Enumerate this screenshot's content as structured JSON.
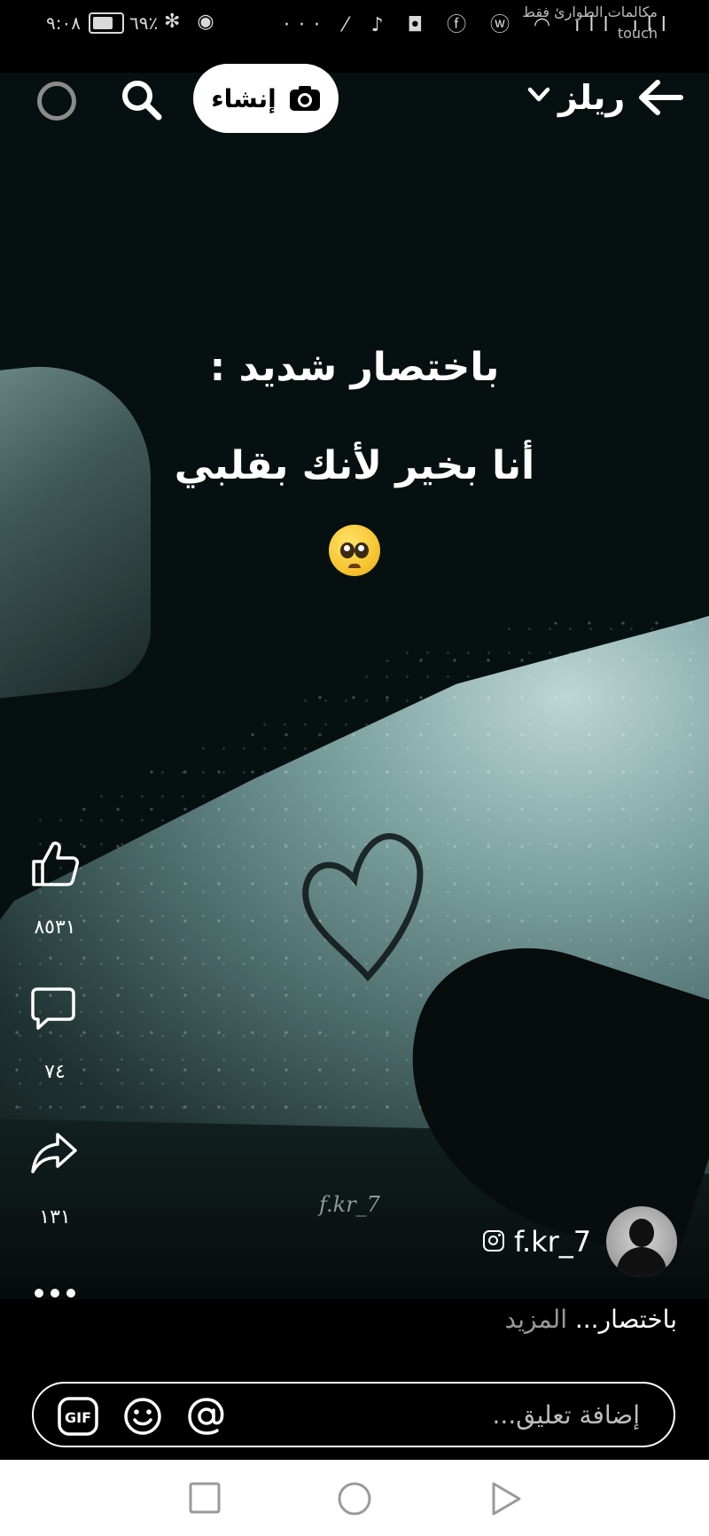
{
  "status_bar": {
    "time": "٩:٠٨",
    "battery_percent": "٦٩٪",
    "carrier_line1": "مكالمات الطوارئ فقط",
    "carrier_line2": "touch",
    "icons": [
      "battery-icon",
      "bluetooth-icon",
      "eye-comfort-icon",
      "more-notifications-icon",
      "link-icon",
      "tiktok-icon",
      "app-icon",
      "facebook-icon",
      "whatsapp-icon",
      "wifi-icon",
      "signal-icon"
    ]
  },
  "header": {
    "title": "ريلز",
    "create_label": "إنشاء"
  },
  "reel": {
    "text_line1": "باختصار شديد :",
    "text_line2": "أنا بخير لأنك بقلبي",
    "emoji": "pleading-face",
    "watermark": "f.kr_7"
  },
  "actions": {
    "likes": "٨٥٣١",
    "comments": "٧٤",
    "shares": "١٣١"
  },
  "author": {
    "username": "f.kr_7"
  },
  "caption": {
    "text": "باختصار...",
    "more": "المزيد"
  },
  "comment_bar": {
    "placeholder": "إضافة تعليق...",
    "gif_label": "GIF"
  },
  "colors": {
    "background": "#000000",
    "text": "#ffffff",
    "muted": "#9a9a9a",
    "navbar": "#ffffff"
  }
}
